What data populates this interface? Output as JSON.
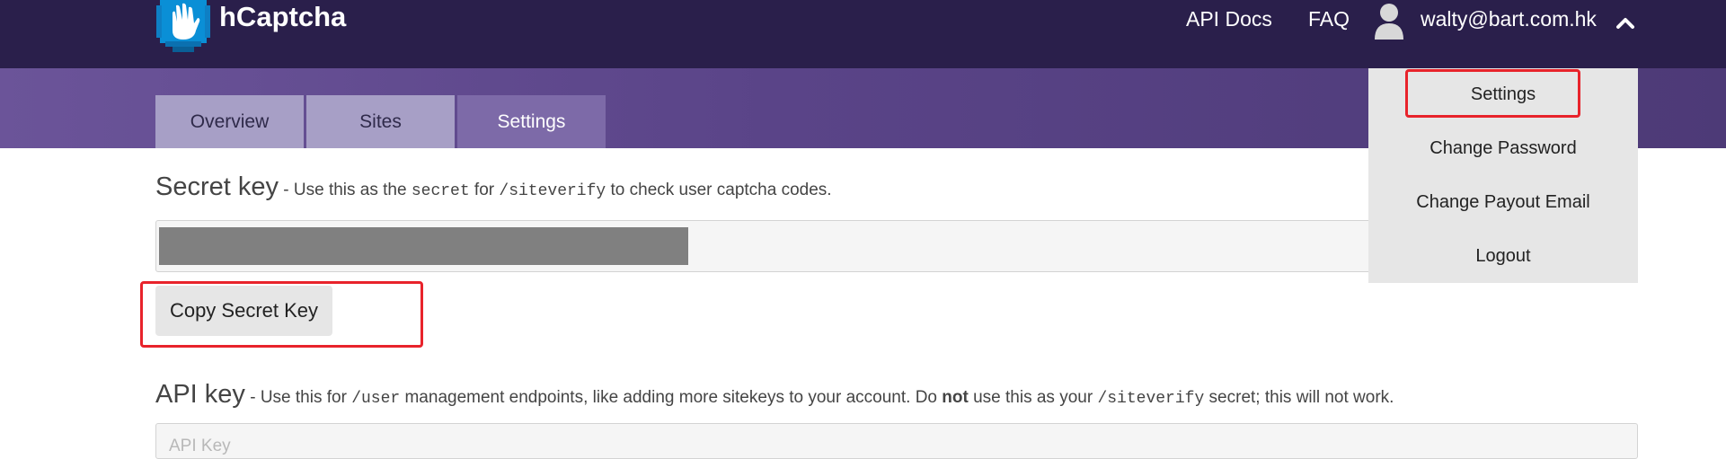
{
  "header": {
    "logo_text": "hCaptcha",
    "nav_links": [
      "API Docs",
      "FAQ"
    ],
    "user_email": "walty@bart.com.hk",
    "brand_color": "#0a8fd6",
    "bg_color": "#2a1f4b"
  },
  "tabs": [
    {
      "label": "Overview",
      "active": false
    },
    {
      "label": "Sites",
      "active": false
    },
    {
      "label": "Settings",
      "active": true
    }
  ],
  "user_menu": {
    "items": [
      "Settings",
      "Change Password",
      "Change Payout Email",
      "Logout"
    ]
  },
  "secret_key": {
    "title": "Secret key",
    "desc_1": " - Use this as the ",
    "code_1": "secret",
    "desc_2": " for ",
    "code_2": "/siteverify",
    "desc_3": " to check user captcha codes.",
    "copy_button": "Copy Secret Key"
  },
  "api_key": {
    "title": "API key",
    "desc_1": " - Use this for ",
    "code_1": "/user",
    "desc_2": " management endpoints, like adding more sitekeys to your account. Do ",
    "bold": "not",
    "desc_3": " use this as your ",
    "code_2": "/siteverify",
    "desc_4": " secret; this will not work.",
    "placeholder": "API Key"
  },
  "annotation_color": "#e8232b"
}
